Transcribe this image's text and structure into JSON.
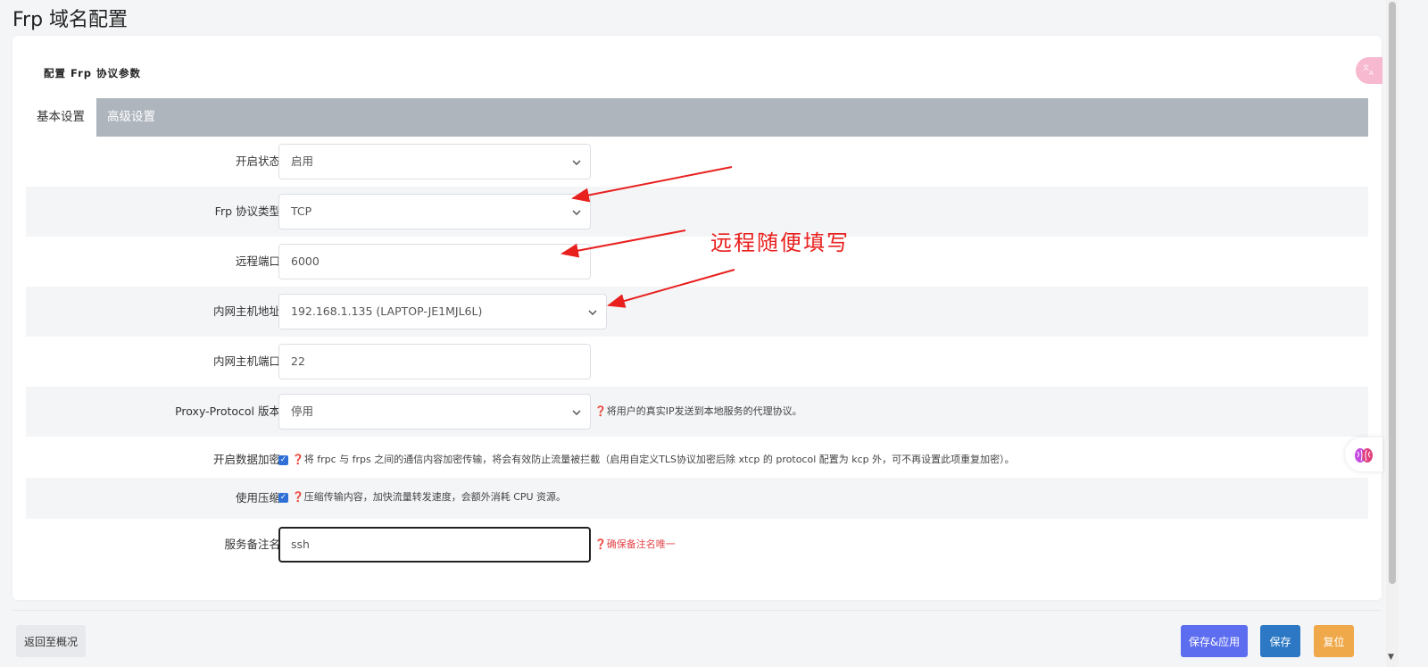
{
  "page": {
    "title": "Frp 域名配置"
  },
  "section": {
    "title": "配置 Frp 协议参数"
  },
  "tabs": [
    {
      "label": "基本设置",
      "active": true
    },
    {
      "label": "高级设置",
      "active": false
    }
  ],
  "form": {
    "status": {
      "label": "开启状态",
      "value": "启用"
    },
    "protocol": {
      "label": "Frp 协议类型",
      "value": "TCP"
    },
    "remote_port": {
      "label": "远程端口",
      "value": "6000"
    },
    "lan_host": {
      "label": "内网主机地址",
      "value": "192.168.1.135 (LAPTOP-JE1MJL6L)"
    },
    "lan_port": {
      "label": "内网主机端口",
      "value": "22"
    },
    "proxy_protocol": {
      "label": "Proxy-Protocol 版本",
      "value": "停用",
      "hint": "❓将用户的真实IP发送到本地服务的代理协议。"
    },
    "encryption": {
      "label": "开启数据加密",
      "checked": true,
      "hint": "❓将 frpc 与 frps 之间的通信内容加密传输，将会有效防止流量被拦截（启用自定义TLS协议加密后除 xtcp 的 protocol 配置为 kcp 外，可不再设置此项重复加密）。"
    },
    "compression": {
      "label": "使用压缩",
      "checked": true,
      "hint": "❓压缩传输内容，加快流量转发速度，会额外消耗 CPU 资源。"
    },
    "remark": {
      "label": "服务备注名",
      "value": "ssh",
      "hint": "❓确保备注名唯一"
    }
  },
  "annotation": {
    "text": "远程随便填写",
    "color": "#e8211f"
  },
  "footer": {
    "back": "返回至概况",
    "save_apply": "保存&应用",
    "save": "保存",
    "reset": "复位"
  },
  "colors": {
    "tabbar": "#aeb5bd",
    "save_apply": "#5d6df0",
    "save": "#2c78c5",
    "reset": "#f0a94a",
    "checkbox": "#2f6fd6",
    "hint_red": "#e4464b"
  },
  "side_badges": {
    "translate_icon": "translate-icon",
    "brain_icon": "brain-icon"
  }
}
